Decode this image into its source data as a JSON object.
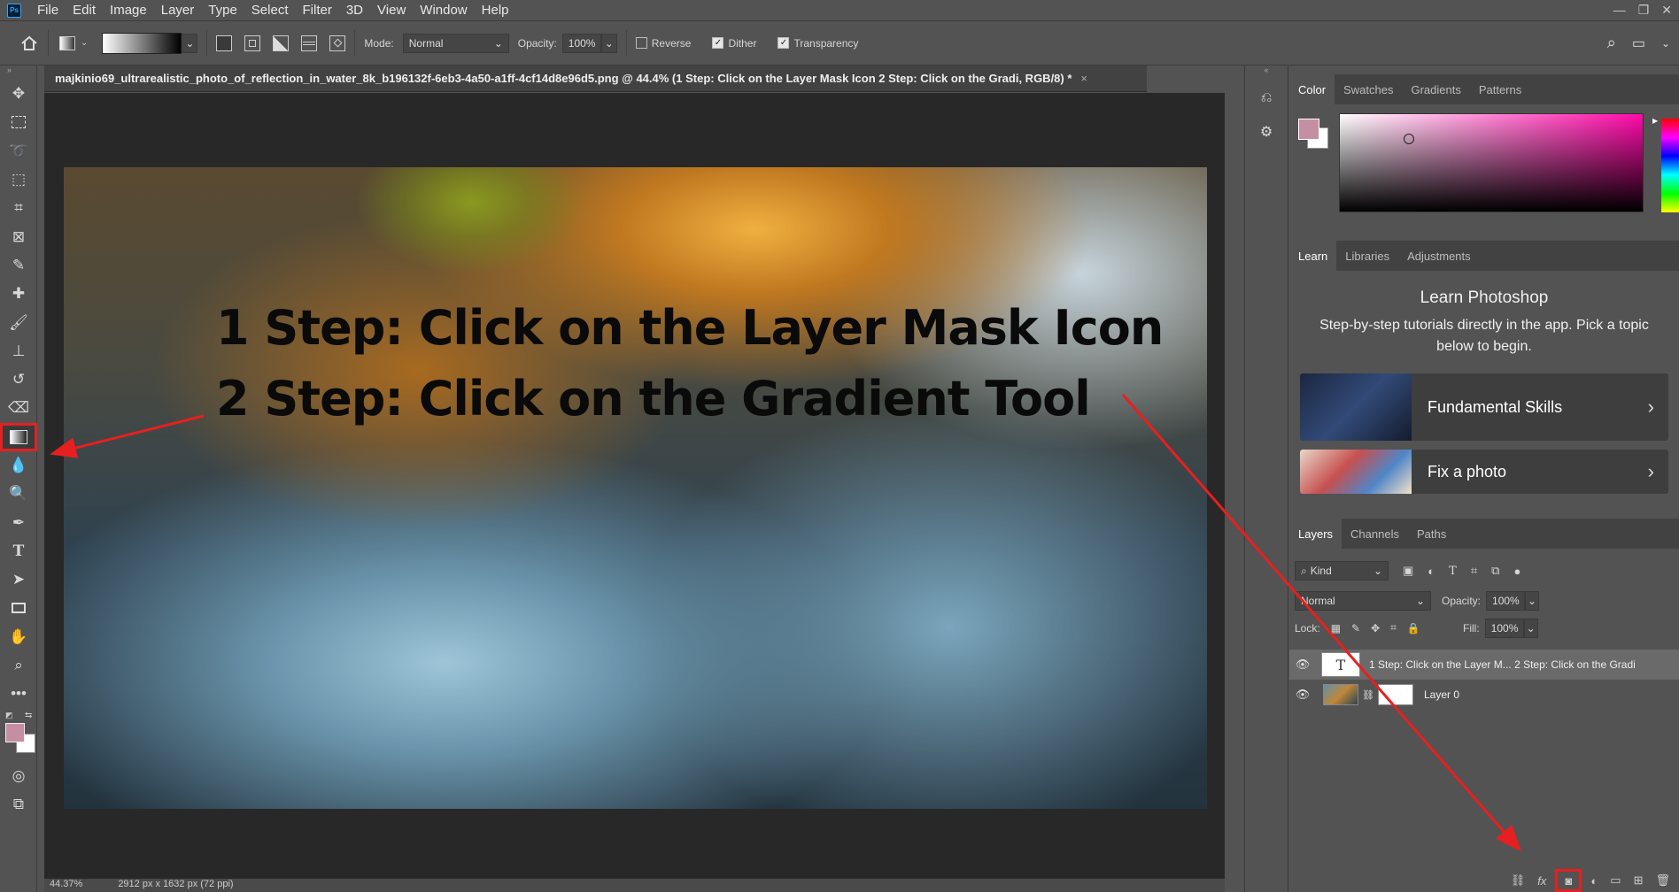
{
  "menu": {
    "logo": "Ps",
    "items": [
      "File",
      "Edit",
      "Image",
      "Layer",
      "Type",
      "Select",
      "Filter",
      "3D",
      "View",
      "Window",
      "Help"
    ]
  },
  "options": {
    "mode_label": "Mode:",
    "mode_value": "Normal",
    "opacity_label": "Opacity:",
    "opacity_value": "100%",
    "reverse_label": "Reverse",
    "reverse_checked": false,
    "dither_label": "Dither",
    "dither_checked": true,
    "transparency_label": "Transparency",
    "transparency_checked": true
  },
  "document": {
    "tab_title": "majkinio69_ultrarealistic_photo_of_reflection_in_water_8k_b196132f-6eb3-4a50-a1ff-4cf14d8e96d5.png @ 44.4% (1 Step: Click on the Layer Mask Icon 2 Step: Click on the Gradi, RGB/8) *",
    "close": "×",
    "line1": "1 Step: Click on the Layer Mask Icon",
    "line2": "2 Step: Click on the Gradient Tool"
  },
  "status": {
    "zoom": "44.37%",
    "size": "2912 px x 1632 px (72 ppi)"
  },
  "color_panel": {
    "tabs": [
      "Color",
      "Swatches",
      "Gradients",
      "Patterns"
    ],
    "active_tab": "Color",
    "foreground": "#c48fa2",
    "background": "#ffffff"
  },
  "learn_panel": {
    "tabs": [
      "Learn",
      "Libraries",
      "Adjustments"
    ],
    "title": "Learn Photoshop",
    "description": "Step-by-step tutorials directly in the app. Pick a topic below to begin.",
    "cards": [
      {
        "title": "Fundamental Skills"
      },
      {
        "title": "Fix a photo"
      }
    ]
  },
  "layers_panel": {
    "tabs": [
      "Layers",
      "Channels",
      "Paths"
    ],
    "filter_label": "Kind",
    "blend_mode": "Normal",
    "opacity_label": "Opacity:",
    "opacity_value": "100%",
    "lock_label": "Lock:",
    "fill_label": "Fill:",
    "fill_value": "100%",
    "layers": [
      {
        "name": "1 Step: Click on the Layer M... 2 Step: Click on the Gradi",
        "type": "text"
      },
      {
        "name": "Layer 0",
        "type": "image-with-mask"
      }
    ],
    "bottom_icons": [
      "link-icon",
      "fx-icon",
      "add-mask-icon",
      "adjustment-icon",
      "group-icon",
      "new-layer-icon",
      "trash-icon"
    ]
  },
  "annotations": {
    "highlight_color": "#e81f1f"
  }
}
